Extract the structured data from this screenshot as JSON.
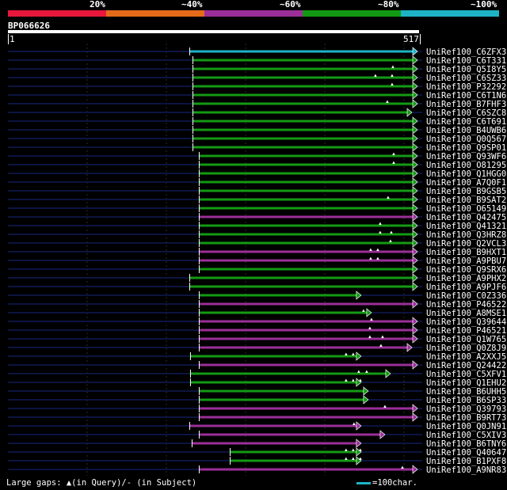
{
  "legend": {
    "segments": [
      {
        "label": "20%",
        "color": "#e8173b"
      },
      {
        "label": "~40%",
        "color": "#e46b1a"
      },
      {
        "label": "~60%",
        "color": "#9b2f99"
      },
      {
        "label": "~80%",
        "color": "#139a13"
      },
      {
        "label": "~100%",
        "color": "#1db3c4"
      }
    ]
  },
  "query": {
    "name": "BP066626",
    "start_label": "1",
    "end_label": "517"
  },
  "footer": {
    "gaps_text": "Large gaps: ▲(in Query)/- (in Subject)",
    "scale_text": "=100char.",
    "scale_color": "#1db3c4"
  },
  "chart_data": {
    "type": "alignment",
    "query_length": 517,
    "colors": {
      "~60%": "#9b2f99",
      "~80%": "#139a13",
      "~100%": "#1db3c4"
    },
    "hits": [
      {
        "name": "UniRef100_C6ZFX3",
        "start": 230,
        "end": 517,
        "identity": "~100%",
        "gaps": []
      },
      {
        "name": "UniRef100_C6T331",
        "start": 234,
        "end": 517,
        "identity": "~80%",
        "gaps": []
      },
      {
        "name": "UniRef100_Q5I8Y5",
        "start": 234,
        "end": 517,
        "identity": "~80%",
        "gaps": [
          486
        ]
      },
      {
        "name": "UniRef100_C6SZ33",
        "start": 234,
        "end": 517,
        "identity": "~80%",
        "gaps": [
          464,
          485
        ]
      },
      {
        "name": "UniRef100_P32292",
        "start": 234,
        "end": 517,
        "identity": "~80%",
        "gaps": [
          485
        ]
      },
      {
        "name": "UniRef100_C6T1N6",
        "start": 234,
        "end": 517,
        "identity": "~80%",
        "gaps": []
      },
      {
        "name": "UniRef100_B7FHF3",
        "start": 234,
        "end": 517,
        "identity": "~80%",
        "gaps": [
          479
        ]
      },
      {
        "name": "UniRef100_C6SZC8",
        "start": 234,
        "end": 510,
        "identity": "~80%",
        "gaps": []
      },
      {
        "name": "UniRef100_C6T691",
        "start": 234,
        "end": 517,
        "identity": "~80%",
        "gaps": []
      },
      {
        "name": "UniRef100_B4UWB6",
        "start": 234,
        "end": 517,
        "identity": "~80%",
        "gaps": []
      },
      {
        "name": "UniRef100_Q0Q567",
        "start": 234,
        "end": 517,
        "identity": "~80%",
        "gaps": []
      },
      {
        "name": "UniRef100_Q9SP01",
        "start": 234,
        "end": 517,
        "identity": "~80%",
        "gaps": []
      },
      {
        "name": "UniRef100_Q93WF6",
        "start": 242,
        "end": 517,
        "identity": "~80%",
        "gaps": [
          487
        ]
      },
      {
        "name": "UniRef100_O81295",
        "start": 242,
        "end": 517,
        "identity": "~80%",
        "gaps": [
          487
        ]
      },
      {
        "name": "UniRef100_Q1HGG0",
        "start": 242,
        "end": 517,
        "identity": "~80%",
        "gaps": []
      },
      {
        "name": "UniRef100_A7Q0F1",
        "start": 242,
        "end": 517,
        "identity": "~80%",
        "gaps": []
      },
      {
        "name": "UniRef100_B9GSB5",
        "start": 242,
        "end": 517,
        "identity": "~80%",
        "gaps": []
      },
      {
        "name": "UniRef100_B9SAT2",
        "start": 242,
        "end": 517,
        "identity": "~80%",
        "gaps": [
          480
        ]
      },
      {
        "name": "UniRef100_O65149",
        "start": 242,
        "end": 517,
        "identity": "~80%",
        "gaps": []
      },
      {
        "name": "UniRef100_Q42475",
        "start": 242,
        "end": 517,
        "identity": "~60%",
        "gaps": []
      },
      {
        "name": "UniRef100_Q41321",
        "start": 242,
        "end": 517,
        "identity": "~80%",
        "gaps": [
          470
        ]
      },
      {
        "name": "UniRef100_Q3HRZ8",
        "start": 242,
        "end": 517,
        "identity": "~80%",
        "gaps": [
          470,
          484
        ]
      },
      {
        "name": "UniRef100_Q2VCL3",
        "start": 242,
        "end": 517,
        "identity": "~80%",
        "gaps": [
          483
        ]
      },
      {
        "name": "UniRef100_B9HXT1",
        "start": 242,
        "end": 517,
        "identity": "~60%",
        "gaps": [
          458,
          467
        ]
      },
      {
        "name": "UniRef100_A9PBU7",
        "start": 242,
        "end": 517,
        "identity": "~60%",
        "gaps": [
          458,
          467
        ]
      },
      {
        "name": "UniRef100_Q9SRX6",
        "start": 242,
        "end": 517,
        "identity": "~80%",
        "gaps": []
      },
      {
        "name": "UniRef100_A9PHX2",
        "start": 230,
        "end": 517,
        "identity": "~80%",
        "gaps": []
      },
      {
        "name": "UniRef100_A9PJF6",
        "start": 230,
        "end": 517,
        "identity": "~80%",
        "gaps": []
      },
      {
        "name": "UniRef100_C0Z336",
        "start": 242,
        "end": 446,
        "identity": "~80%",
        "gaps": []
      },
      {
        "name": "UniRef100_P46522",
        "start": 242,
        "end": 517,
        "identity": "~60%",
        "gaps": []
      },
      {
        "name": "UniRef100_A8MSE1",
        "start": 242,
        "end": 459,
        "identity": "~80%",
        "gaps": [
          449
        ]
      },
      {
        "name": "UniRef100_Q39644",
        "start": 242,
        "end": 517,
        "identity": "~60%",
        "gaps": [
          459
        ]
      },
      {
        "name": "UniRef100_P46521",
        "start": 242,
        "end": 517,
        "identity": "~60%",
        "gaps": [
          457
        ]
      },
      {
        "name": "UniRef100_Q1W765",
        "start": 242,
        "end": 517,
        "identity": "~60%",
        "gaps": [
          457,
          473
        ]
      },
      {
        "name": "UniRef100_Q0Z8J9",
        "start": 242,
        "end": 510,
        "identity": "~60%",
        "gaps": [
          471
        ]
      },
      {
        "name": "UniRef100_A2XXJ5",
        "start": 231,
        "end": 446,
        "identity": "~80%",
        "gaps": [
          427,
          436
        ]
      },
      {
        "name": "UniRef100_Q24422",
        "start": 242,
        "end": 517,
        "identity": "~60%",
        "gaps": []
      },
      {
        "name": "UniRef100_C5XFV1",
        "start": 231,
        "end": 483,
        "identity": "~80%",
        "gaps": [
          443,
          453
        ]
      },
      {
        "name": "UniRef100_Q1EHU2",
        "start": 231,
        "end": 446,
        "identity": "~80%",
        "gaps": [
          427,
          436,
          445
        ]
      },
      {
        "name": "UniRef100_B6UHH5",
        "start": 242,
        "end": 455,
        "identity": "~80%",
        "gaps": []
      },
      {
        "name": "UniRef100_B6SP33",
        "start": 242,
        "end": 455,
        "identity": "~80%",
        "gaps": []
      },
      {
        "name": "UniRef100_Q39793",
        "start": 242,
        "end": 517,
        "identity": "~60%",
        "gaps": [
          476
        ]
      },
      {
        "name": "UniRef100_B9RT73",
        "start": 242,
        "end": 517,
        "identity": "~60%",
        "gaps": []
      },
      {
        "name": "UniRef100_Q0JN91",
        "start": 230,
        "end": 446,
        "identity": "~60%",
        "gaps": [
          437
        ]
      },
      {
        "name": "UniRef100_C5XIV3",
        "start": 242,
        "end": 476,
        "identity": "~60%",
        "gaps": []
      },
      {
        "name": "UniRef100_B6TNY6",
        "start": 233,
        "end": 446,
        "identity": "~60%",
        "gaps": []
      },
      {
        "name": "UniRef100_Q40647",
        "start": 281,
        "end": 446,
        "identity": "~80%",
        "gaps": [
          427,
          436,
          445
        ]
      },
      {
        "name": "UniRef100_B1PXF8",
        "start": 281,
        "end": 446,
        "identity": "~80%",
        "gaps": [
          427,
          436,
          445
        ]
      },
      {
        "name": "UniRef100_A9NR83",
        "start": 242,
        "end": 517,
        "identity": "~60%",
        "gaps": [
          498
        ]
      }
    ]
  }
}
